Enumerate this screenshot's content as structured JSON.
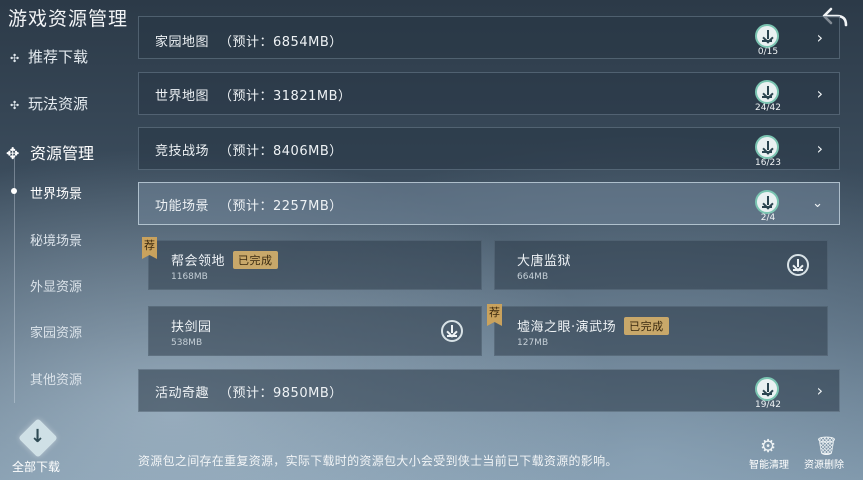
{
  "header": {
    "title": "游戏资源管理"
  },
  "sidebar": {
    "items": [
      {
        "label": "推荐下载"
      },
      {
        "label": "玩法资源"
      },
      {
        "label": "资源管理"
      }
    ],
    "sub_items": [
      {
        "label": "世界场景"
      },
      {
        "label": "秘境场景"
      },
      {
        "label": "外显资源"
      },
      {
        "label": "家园资源"
      },
      {
        "label": "其他资源"
      }
    ],
    "download_all_label": "全部下载"
  },
  "rows": [
    {
      "name": "家园地图",
      "estimate": "（预计：6854MB）",
      "count": "0/15"
    },
    {
      "name": "世界地图",
      "estimate": "（预计：31821MB）",
      "count": "24/42"
    },
    {
      "name": "竞技战场",
      "estimate": "（预计：8406MB）",
      "count": "16/23"
    },
    {
      "name": "功能场景",
      "estimate": "（预计：2257MB）",
      "count": "2/4"
    },
    {
      "name": "活动奇趣",
      "estimate": "（预计：9850MB）",
      "count": "19/42"
    }
  ],
  "cards": [
    {
      "name": "帮会领地",
      "size": "1168MB",
      "badge": "已完成",
      "rec": "荐"
    },
    {
      "name": "大唐监狱",
      "size": "664MB"
    },
    {
      "name": "扶剑园",
      "size": "538MB"
    },
    {
      "name": "墟海之眼·演武场",
      "size": "127MB",
      "badge": "已完成",
      "rec": "荐"
    }
  ],
  "footer": {
    "notice": "资源包之间存在重复资源，实际下载时的资源包大小会受到侠士当前已下载资源的影响。",
    "clean_label": "智能清理",
    "delete_label": "资源删除"
  }
}
